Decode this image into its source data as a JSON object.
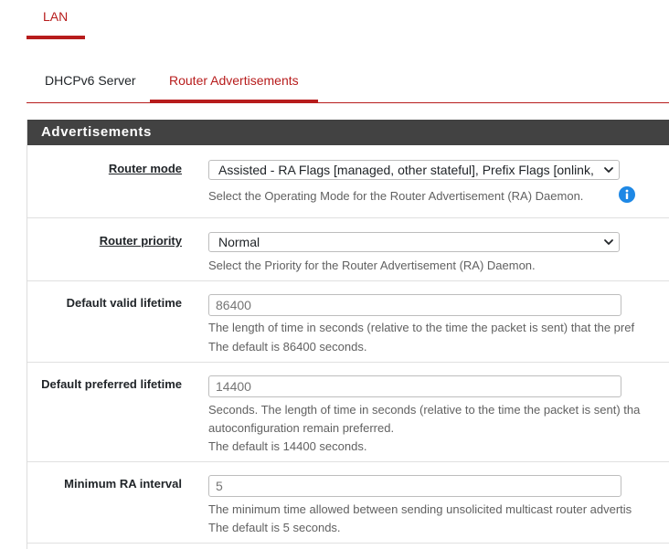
{
  "top_tabs": [
    {
      "label": "LAN"
    }
  ],
  "sub_tabs": [
    {
      "label": "DHCPv6 Server"
    },
    {
      "label": "Router Advertisements"
    }
  ],
  "panel": {
    "title": "Advertisements"
  },
  "fields": {
    "router_mode": {
      "label": "Router mode",
      "value": "Assisted - RA Flags [managed, other stateful], Prefix Flags [onlink, auto, router]",
      "help": "Select the Operating Mode for the Router Advertisement (RA) Daemon."
    },
    "router_priority": {
      "label": "Router priority",
      "value": "Normal",
      "help": "Select the Priority for the Router Advertisement (RA) Daemon."
    },
    "default_valid_lifetime": {
      "label": "Default valid lifetime",
      "placeholder": "86400",
      "help_lines": [
        "The length of time in seconds (relative to the time the packet is sent) that the pref",
        "The default is 86400 seconds."
      ]
    },
    "default_preferred_lifetime": {
      "label": "Default preferred lifetime",
      "placeholder": "14400",
      "help_lines": [
        "Seconds. The length of time in seconds (relative to the time the packet is sent) tha",
        "autoconfiguration remain preferred.",
        "The default is 14400 seconds."
      ]
    },
    "minimum_ra_interval": {
      "label": "Minimum RA interval",
      "placeholder": "5",
      "help_lines": [
        "The minimum time allowed between sending unsolicited multicast router advertis",
        "The default is 5 seconds."
      ]
    }
  },
  "colors": {
    "accent": "#b71c1c",
    "heading_bg": "#424242",
    "info": "#1e88e5"
  },
  "icons": {
    "info": "info-circle-icon",
    "dropdown": "chevron-down-icon"
  }
}
